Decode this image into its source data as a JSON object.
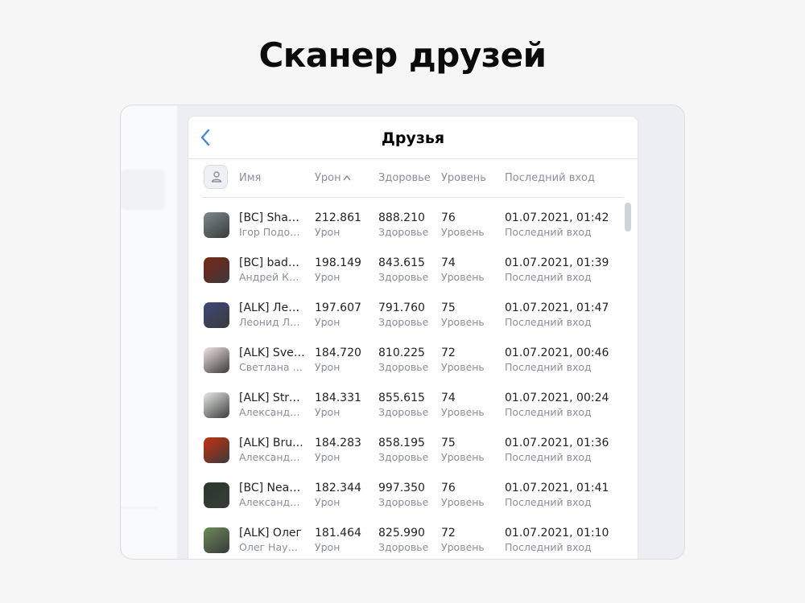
{
  "headline": "Сканер друзей",
  "modal": {
    "title": "Друзья",
    "columns": {
      "name": "Имя",
      "damage": "Урон",
      "health": "Здоровье",
      "level": "Уровень",
      "last_login": "Последний вход"
    },
    "sort": {
      "column": "damage",
      "indicator": "^"
    },
    "rows": [
      {
        "nick": "[BC] ShaD...",
        "real_name": "Ігор Подоляк",
        "damage": "212.861",
        "damage_label": "Урон",
        "health": "888.210",
        "health_label": "Здоровье",
        "level": "76",
        "level_label": "Уровень",
        "last_login": "01.07.2021, 01:42",
        "last_login_label": "Последний вход",
        "avatar_color": "#7d8a8e"
      },
      {
        "nick": "[BC] badger",
        "real_name": "Андрей Коч...",
        "damage": "198.149",
        "damage_label": "Урон",
        "health": "843.615",
        "health_label": "Здоровье",
        "level": "74",
        "level_label": "Уровень",
        "last_login": "01.07.2021, 01:39",
        "last_login_label": "Последний вход",
        "avatar_color": "#7a2418"
      },
      {
        "nick": "[ALK] Лео...",
        "real_name": "Леонид Лав...",
        "damage": "197.607",
        "damage_label": "Урон",
        "health": "791.760",
        "health_label": "Здоровье",
        "level": "75",
        "level_label": "Уровень",
        "last_login": "01.07.2021, 01:47",
        "last_login_label": "Последний вход",
        "avatar_color": "#3d4a7a"
      },
      {
        "nick": "[ALK] Svetl...",
        "real_name": "Светлана А...",
        "damage": "184.720",
        "damage_label": "Урон",
        "health": "810.225",
        "health_label": "Здоровье",
        "level": "72",
        "level_label": "Уровень",
        "last_login": "01.07.2021, 00:46",
        "last_login_label": "Последний вход",
        "avatar_color": "#f2e4e4"
      },
      {
        "nick": "[ALK] Stro...",
        "real_name": "Александр ...",
        "damage": "184.331",
        "damage_label": "Урон",
        "health": "855.615",
        "health_label": "Здоровье",
        "level": "74",
        "level_label": "Уровень",
        "last_login": "01.07.2021, 00:24",
        "last_login_label": "Последний вход",
        "avatar_color": "#e8ebe8"
      },
      {
        "nick": "[ALK] Bru...",
        "real_name": "Александр ...",
        "damage": "184.283",
        "damage_label": "Урон",
        "health": "858.195",
        "health_label": "Здоровье",
        "level": "75",
        "level_label": "Уровень",
        "last_login": "01.07.2021, 01:36",
        "last_login_label": "Последний вход",
        "avatar_color": "#c8300e"
      },
      {
        "nick": "[BC] Neakris",
        "real_name": "Александр ...",
        "damage": "182.344",
        "damage_label": "Урон",
        "health": "997.350",
        "health_label": "Здоровье",
        "level": "76",
        "level_label": "Уровень",
        "last_login": "01.07.2021, 01:41",
        "last_login_label": "Последний вход",
        "avatar_color": "#2a3a2a"
      },
      {
        "nick": "[ALK] Олег",
        "real_name": "Олег Наумов",
        "damage": "181.464",
        "damage_label": "Урон",
        "health": "825.990",
        "health_label": "Здоровье",
        "level": "72",
        "level_label": "Уровень",
        "last_login": "01.07.2021, 01:10",
        "last_login_label": "Последний вход",
        "avatar_color": "#6c8a5a"
      }
    ]
  },
  "icons": {
    "back": "chevron-left-icon",
    "user_column": "user-icon"
  },
  "colors": {
    "accent": "#3f8ae0",
    "text_secondary": "#8a8f99"
  }
}
